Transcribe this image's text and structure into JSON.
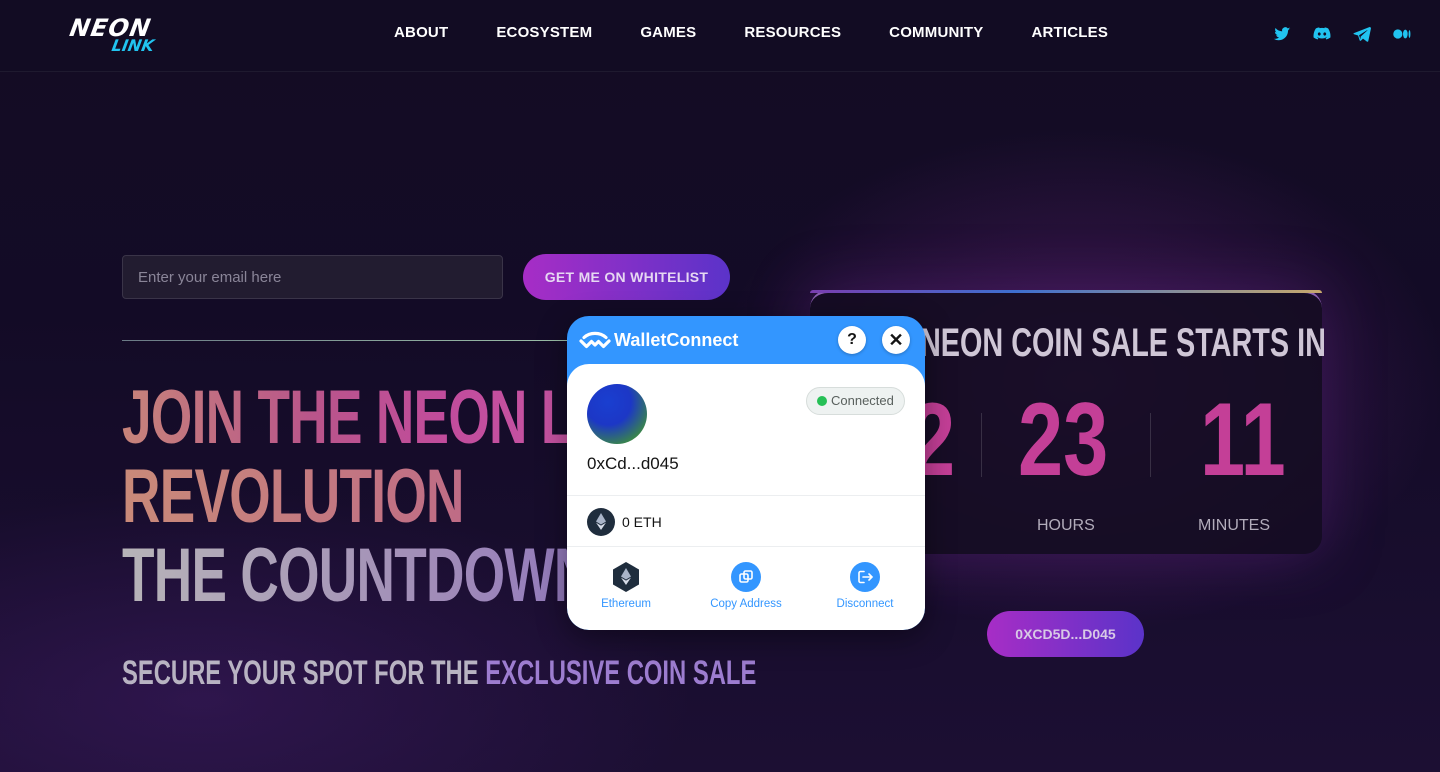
{
  "brand": {
    "logo_top": "NEON",
    "logo_bottom": "LINK"
  },
  "nav": {
    "items": [
      "ABOUT",
      "ECOSYSTEM",
      "GAMES",
      "RESOURCES",
      "COMMUNITY",
      "ARTICLES"
    ]
  },
  "socials": [
    "twitter-icon",
    "discord-icon",
    "telegram-icon",
    "medium-icon"
  ],
  "colors": {
    "accent_cyan": "#21c4f0",
    "accent_magenta": "#c43f97",
    "walletconnect_blue": "#3396ff",
    "connected_green": "#26c056"
  },
  "hero": {
    "email_placeholder": "Enter your email here",
    "whitelist_button": "GET ME ON WHITELIST",
    "headline_1": "JOIN THE NEON LINK",
    "headline_2": "REVOLUTION",
    "headline_3": "THE COUNTDOWN",
    "subhead_a": "SECURE YOUR SPOT FOR THE",
    "subhead_b": "EXCLUSIVE COIN SALE"
  },
  "countdown": {
    "title": "NEON COIN SALE STARTS IN",
    "days": "2",
    "hours": "23",
    "minutes": "11",
    "hours_label": "HOURS",
    "minutes_label": "MINUTES"
  },
  "wallet_button": "0XCD5D...D045",
  "modal": {
    "title": "WalletConnect",
    "help": "?",
    "close": "✕",
    "status": "Connected",
    "address": "0xCd...d045",
    "balance": "0 ETH",
    "actions": [
      "Ethereum",
      "Copy Address",
      "Disconnect"
    ]
  }
}
